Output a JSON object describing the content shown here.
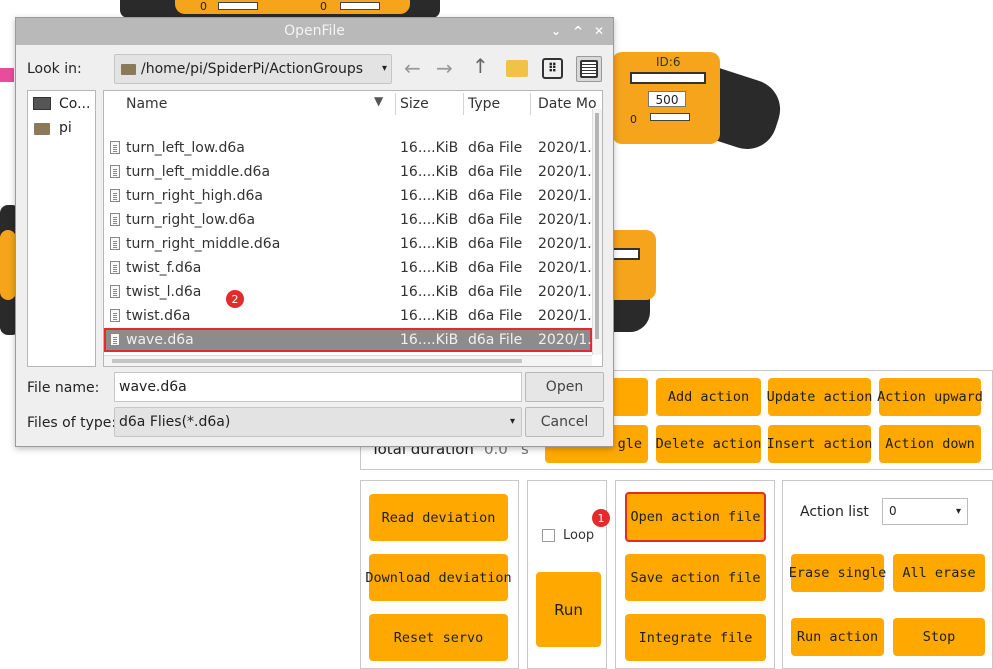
{
  "dialog": {
    "title": "OpenFile",
    "controls": {
      "minimize": "⌄",
      "maximize": "^",
      "close": "✕"
    },
    "look_in_label": "Look in:",
    "path": "/home/pi/SpiderPi/ActionGroups",
    "sidebar": [
      {
        "label": "Co...",
        "icon": "computer-icon"
      },
      {
        "label": "pi",
        "icon": "folder-icon"
      }
    ],
    "columns": {
      "name": "Name",
      "size": "Size",
      "type": "Type",
      "date": "Date Mo"
    },
    "files": [
      {
        "name": "turn_left_low.d6a",
        "size": "16....KiB",
        "type": "d6a File",
        "date": "2020/1..."
      },
      {
        "name": "turn_left_middle.d6a",
        "size": "16....KiB",
        "type": "d6a File",
        "date": "2020/1..."
      },
      {
        "name": "turn_right_high.d6a",
        "size": "16....KiB",
        "type": "d6a File",
        "date": "2020/1..."
      },
      {
        "name": "turn_right_low.d6a",
        "size": "16....KiB",
        "type": "d6a File",
        "date": "2020/1..."
      },
      {
        "name": "turn_right_middle.d6a",
        "size": "16....KiB",
        "type": "d6a File",
        "date": "2020/1..."
      },
      {
        "name": "twist_f.d6a",
        "size": "16....KiB",
        "type": "d6a File",
        "date": "2020/1..."
      },
      {
        "name": "twist_l.d6a",
        "size": "16....KiB",
        "type": "d6a File",
        "date": "2020/1..."
      },
      {
        "name": "twist.d6a",
        "size": "16....KiB",
        "type": "d6a File",
        "date": "2020/1..."
      },
      {
        "name": "wave.d6a",
        "size": "16....KiB",
        "type": "d6a File",
        "date": "2020/1...",
        "selected": true
      }
    ],
    "file_name_label": "File name:",
    "file_name_value": "wave.d6a",
    "files_of_type_label": "Files of type:",
    "files_of_type_value": "d6a Flies(*.d6a)",
    "open_label": "Open",
    "cancel_label": "Cancel"
  },
  "app": {
    "servo_id": "ID:6",
    "servo_value": "500",
    "slider_zero": "0",
    "top_zeros": [
      "0",
      "0"
    ],
    "total_duration_label": "Total duration",
    "total_duration_value": "0.0",
    "total_duration_unit": "s",
    "action_buttons": {
      "add_action": "Add action",
      "update_action": "Update action",
      "action_upward": "Action upward",
      "delete_action": "Delete action",
      "insert_action": "Insert action",
      "action_down": "Action down",
      "partial_single": "gle"
    },
    "deviation": {
      "read": "Read deviation",
      "download": "Download deviation",
      "reset": "Reset servo"
    },
    "loop_label": "Loop",
    "run_label": "Run",
    "files": {
      "open": "Open action file",
      "save": "Save action file",
      "integrate": "Integrate file"
    },
    "action_list_label": "Action list",
    "action_list_value": "0",
    "erase_single": "Erase single",
    "all_erase": "All erase",
    "run_action": "Run action",
    "stop": "Stop"
  },
  "annotations": {
    "badge1": "1",
    "badge2": "2",
    "highlight_color": "#e42b2b"
  }
}
